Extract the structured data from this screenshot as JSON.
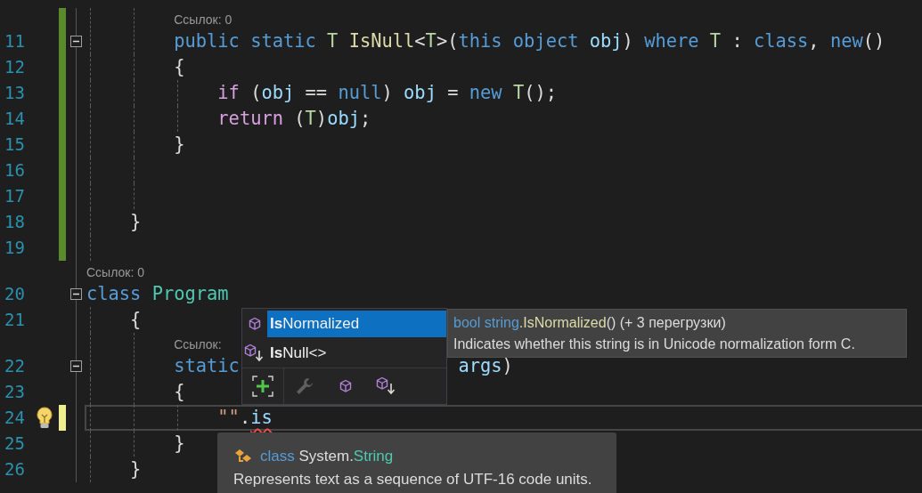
{
  "editor": {
    "lines": [
      {
        "number": "11",
        "lens": "Ссылок: 0",
        "marker": {
          "kind": "saved"
        },
        "fold": true,
        "tokens": [
          {
            "t": "        public static",
            "kind": "kw"
          },
          {
            "t": " T",
            "kind": "type"
          },
          {
            "t": " IsNull",
            "kind": "method"
          },
          {
            "t": "<",
            "kind": "punc"
          },
          {
            "t": "T",
            "kind": "type"
          },
          {
            "t": ">(",
            "kind": "punc"
          },
          {
            "t": "this object",
            "kind": "kw"
          },
          {
            "t": " obj",
            "kind": "param"
          },
          {
            "t": ") ",
            "kind": "punc"
          },
          {
            "t": "where",
            "kind": "kw"
          },
          {
            "t": " T",
            "kind": "type"
          },
          {
            "t": " : ",
            "kind": "punc"
          },
          {
            "t": "class",
            "kind": "kw"
          },
          {
            "t": ", ",
            "kind": "punc"
          },
          {
            "t": "new",
            "kind": "kw"
          },
          {
            "t": "()",
            "kind": "punc"
          }
        ]
      },
      {
        "number": "12",
        "marker": {
          "kind": "saved"
        },
        "tokens": [
          {
            "t": "        {",
            "kind": "punc"
          }
        ]
      },
      {
        "number": "13",
        "marker": {
          "kind": "saved"
        },
        "tokens": [
          {
            "t": "            if",
            "kind": "ctl"
          },
          {
            "t": " (",
            "kind": "punc"
          },
          {
            "t": "obj",
            "kind": "param"
          },
          {
            "t": " == ",
            "kind": "punc"
          },
          {
            "t": "null",
            "kind": "kw"
          },
          {
            "t": ") ",
            "kind": "punc"
          },
          {
            "t": "obj",
            "kind": "param"
          },
          {
            "t": " = ",
            "kind": "punc"
          },
          {
            "t": "new",
            "kind": "kw"
          },
          {
            "t": " T",
            "kind": "type"
          },
          {
            "t": "();",
            "kind": "punc"
          }
        ]
      },
      {
        "number": "14",
        "marker": {
          "kind": "saved"
        },
        "tokens": [
          {
            "t": "            return",
            "kind": "ctl"
          },
          {
            "t": " (",
            "kind": "punc"
          },
          {
            "t": "T",
            "kind": "type"
          },
          {
            "t": ")",
            "kind": "punc"
          },
          {
            "t": "obj",
            "kind": "param"
          },
          {
            "t": ";",
            "kind": "punc"
          }
        ]
      },
      {
        "number": "15",
        "marker": {
          "kind": "saved"
        },
        "tokens": [
          {
            "t": "        }",
            "kind": "punc"
          }
        ]
      },
      {
        "number": "16",
        "marker": {
          "kind": "saved"
        }
      },
      {
        "number": "17",
        "marker": {
          "kind": "saved"
        }
      },
      {
        "number": "18",
        "marker": {
          "kind": "saved"
        },
        "tokens": [
          {
            "t": "    }",
            "kind": "punc"
          }
        ]
      },
      {
        "number": "19",
        "marker": {
          "kind": "saved"
        }
      },
      {
        "number": "20",
        "lens": "Ссылок: 0",
        "fold": true,
        "tokens": [
          {
            "t": "class",
            "kind": "kw"
          },
          {
            "t": " Program",
            "kind": "cls"
          }
        ]
      },
      {
        "number": "21",
        "tokens": [
          {
            "t": "    {",
            "kind": "punc"
          }
        ]
      },
      {
        "number": "22",
        "lens": "Ссылок:",
        "fold": true,
        "tokens": [
          {
            "t": "        static",
            "kind": "kw"
          },
          {
            "t": "                    args",
            "kind": "param"
          },
          {
            "t": ")",
            "kind": "punc"
          }
        ]
      },
      {
        "number": "23",
        "tokens": [
          {
            "t": "        {",
            "kind": "punc"
          }
        ]
      },
      {
        "number": "24",
        "marker": {
          "kind": "unsaved"
        },
        "bulb": true,
        "current": true,
        "tokens": [
          {
            "t": "            \"\"",
            "kind": "str"
          },
          {
            "t": ".",
            "kind": "punc"
          },
          {
            "t": "is",
            "kind": "param",
            "error": true
          }
        ]
      },
      {
        "number": "25",
        "tokens": [
          {
            "t": "        }",
            "kind": "punc"
          }
        ]
      },
      {
        "number": "26",
        "tokens": [
          {
            "t": "    }",
            "kind": "punc"
          }
        ]
      }
    ]
  },
  "completion": {
    "items": [
      {
        "label": "**Is**Normalized",
        "kind": "method",
        "selected": true
      },
      {
        "label": "**Is**Null<>",
        "kind": "extension",
        "selected": false
      }
    ],
    "filters": [
      {
        "kind": "expand",
        "disabled": false
      },
      {
        "kind": "wrench",
        "disabled": true
      },
      {
        "kind": "method",
        "disabled": false
      },
      {
        "kind": "extension",
        "disabled": false
      }
    ]
  },
  "description": {
    "signature": [
      {
        "t": "bool string",
        "kind": "kw"
      },
      {
        "t": ".IsNormalized",
        "kind": "method"
      },
      {
        "t": "() (+ 3 перегрузки)",
        "kind": "punc"
      }
    ],
    "text": "Indicates whether this string is in Unicode normalization form C."
  },
  "type_tooltip": {
    "header": [
      {
        "t": "class",
        "kind": "kw"
      },
      {
        "t": " System.",
        "kind": "punc"
      },
      {
        "t": "String",
        "kind": "cls"
      }
    ],
    "text": "Represents text as a sequence of UTF-16 code units."
  }
}
